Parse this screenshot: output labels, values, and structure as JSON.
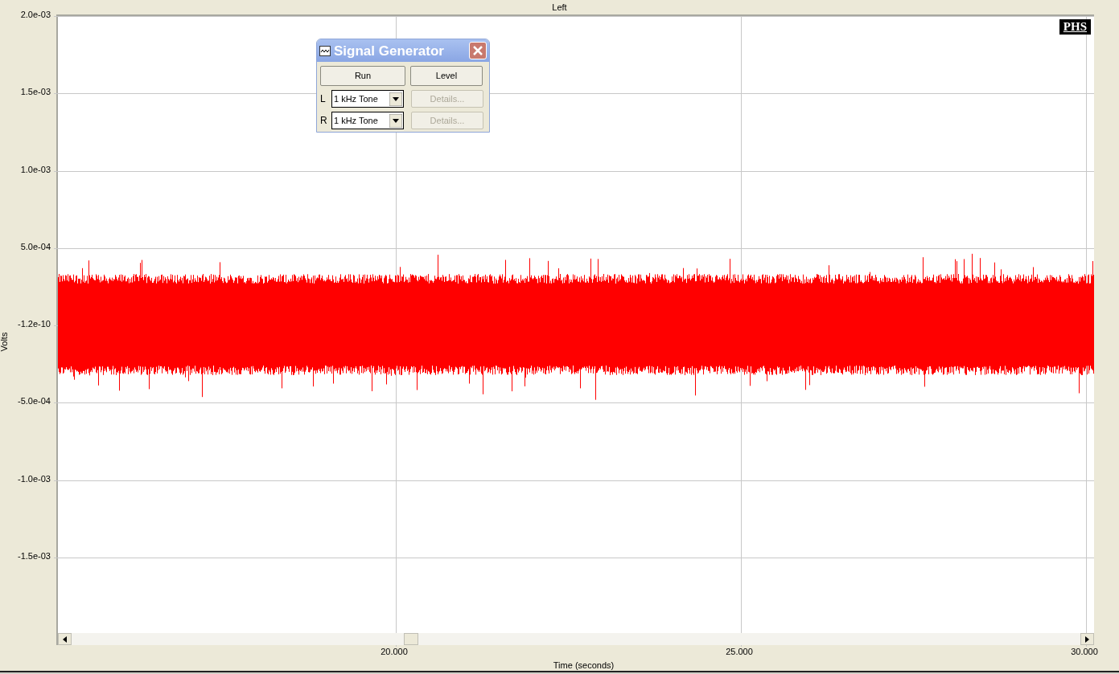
{
  "chart": {
    "title": "Left",
    "ylabel": "Volts",
    "xlabel": "Time (seconds)",
    "y_ticks": [
      "2.0e-03",
      "1.5e-03",
      "1.0e-03",
      "5.0e-04",
      "-1.2e-10",
      "-5.0e-04",
      "-1.0e-03",
      "-1.5e-03"
    ],
    "x_ticks": [
      "20.000",
      "25.000",
      "30.000"
    ]
  },
  "badge": "PHS",
  "dialog": {
    "title": "Signal Generator",
    "buttons": [
      {
        "label": "Run",
        "disabled": false
      },
      {
        "label": "Level",
        "disabled": false
      }
    ],
    "channels": [
      {
        "label": "L",
        "value": "1 kHz Tone",
        "details": "Details...",
        "details_disabled": true
      },
      {
        "label": "R",
        "value": "1 kHz Tone",
        "details": "Details...",
        "details_disabled": true
      }
    ]
  }
}
